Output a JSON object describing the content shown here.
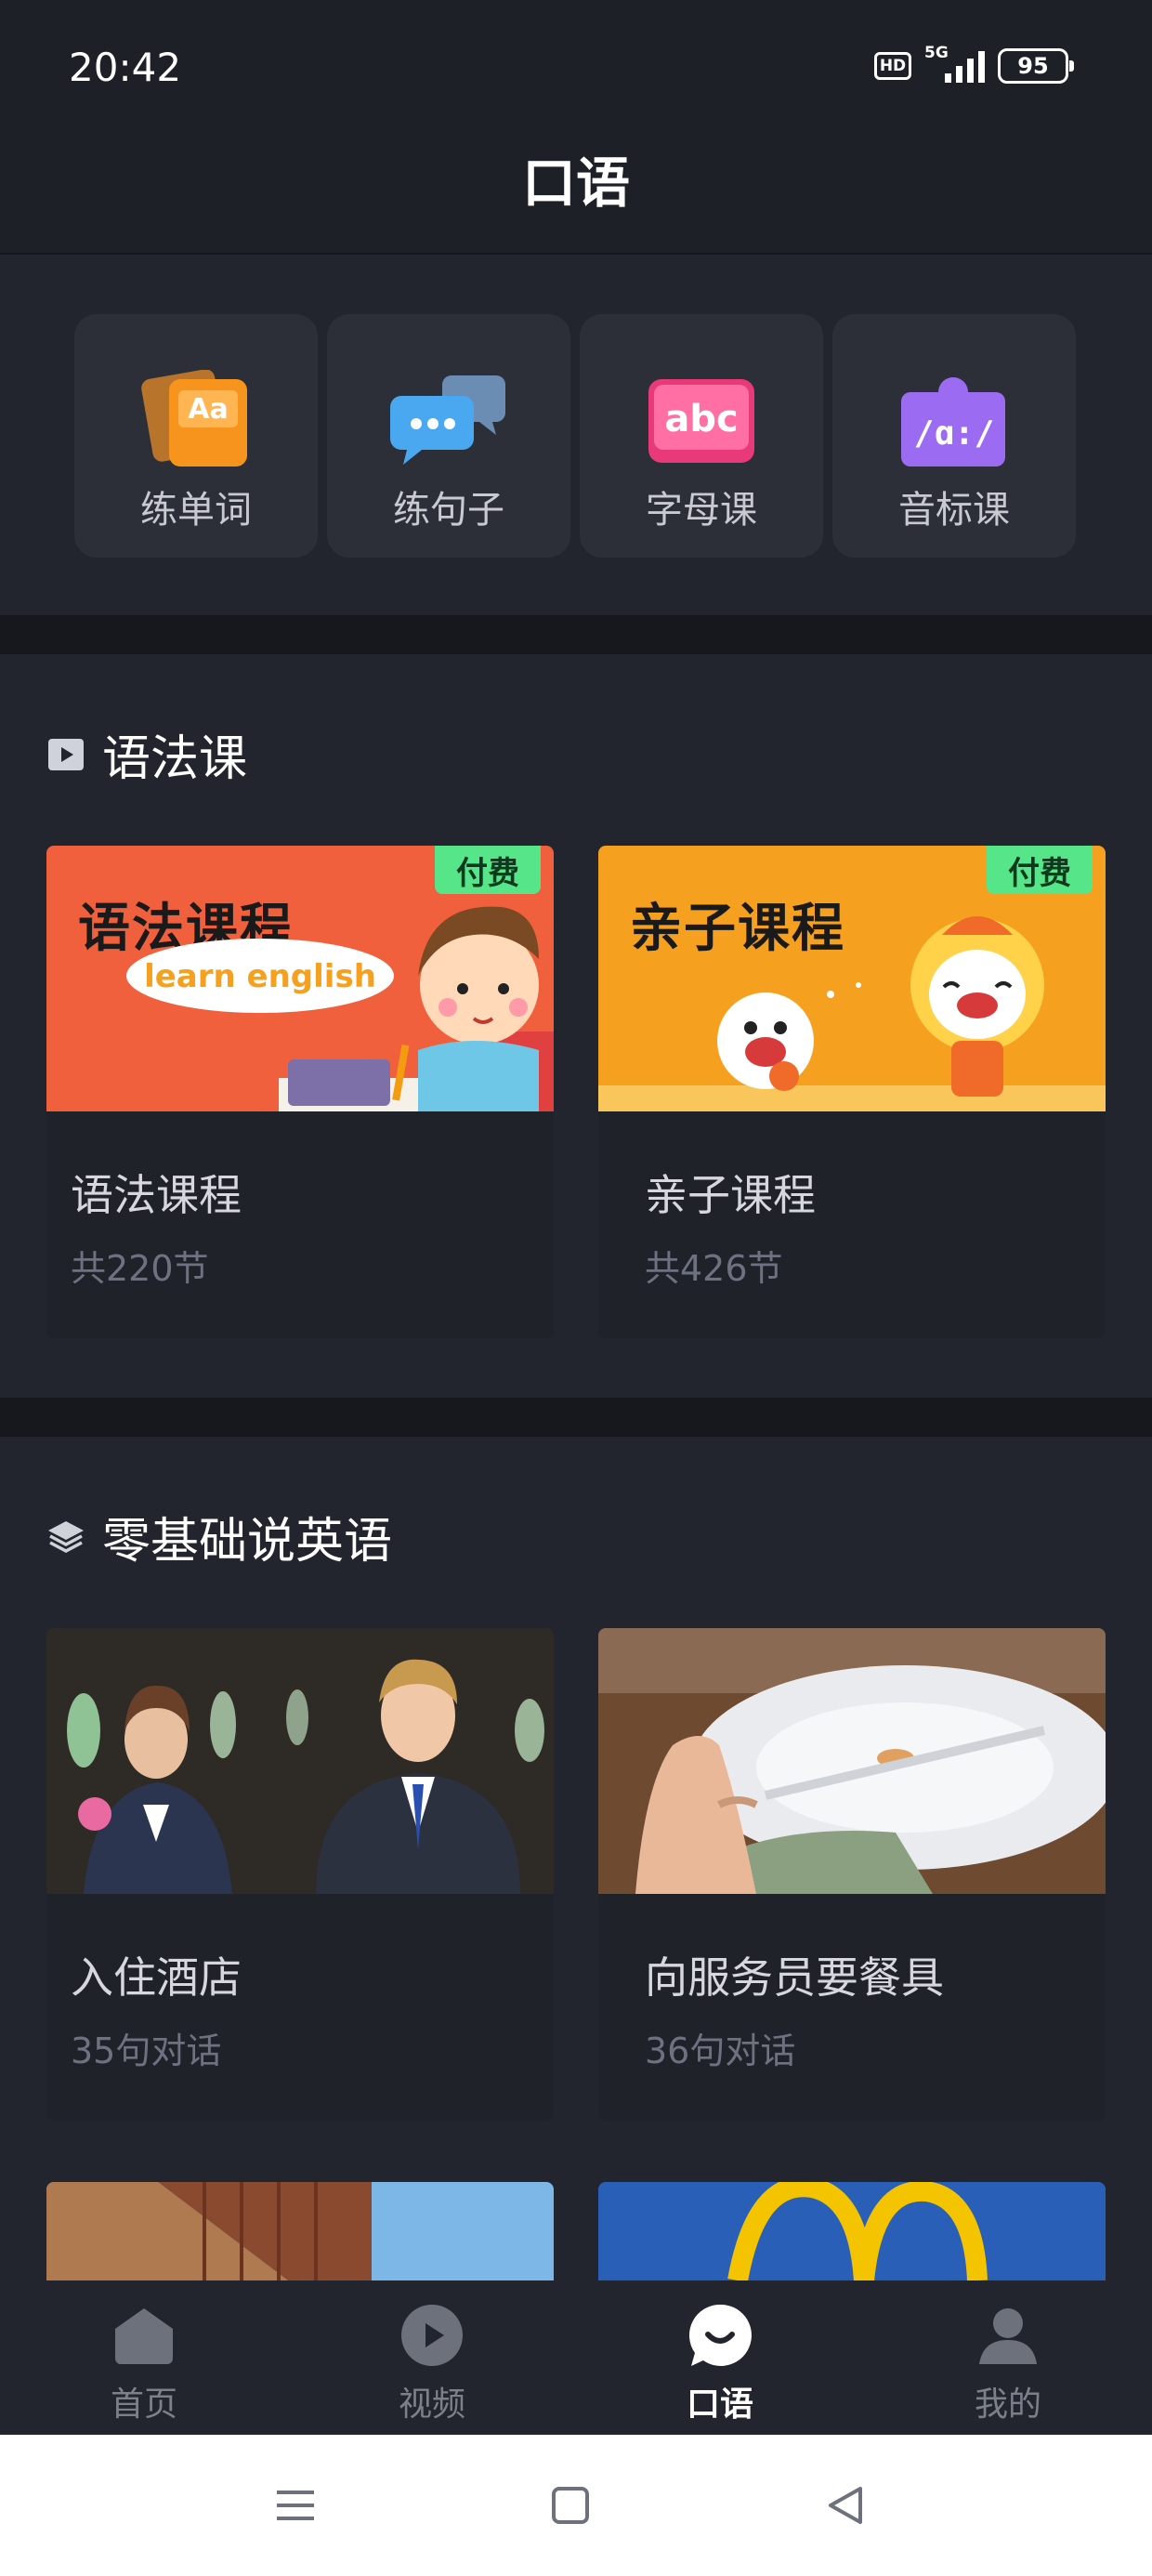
{
  "status_bar": {
    "time": "20:42",
    "hd": "HD",
    "network": "5G",
    "battery": "95"
  },
  "header": {
    "title": "口语"
  },
  "quick_entries": [
    {
      "label": "练单词",
      "icon": "word-card-icon",
      "color": "#f7941d"
    },
    {
      "label": "练句子",
      "icon": "chat-bubbles-icon",
      "color": "#4aa8f0"
    },
    {
      "label": "字母课",
      "icon": "abc-icon",
      "color": "#f0508a"
    },
    {
      "label": "音标课",
      "icon": "phonetic-icon",
      "color": "#9b6cf2"
    }
  ],
  "grammar_section": {
    "title": "语法课",
    "icon": "play-square-icon",
    "courses": [
      {
        "cover_title": "语法课程",
        "cover_caption": "learn english",
        "badge": "付费",
        "name": "语法课程",
        "meta": "共220节",
        "cover_color": "#f0603c"
      },
      {
        "cover_title": "亲子课程",
        "badge": "付费",
        "name": "亲子课程",
        "meta": "共426节",
        "cover_color": "#f5a01f"
      }
    ]
  },
  "basic_section": {
    "title": "零基础说英语",
    "icon": "layers-icon",
    "lessons": [
      {
        "name": "入住酒店",
        "meta": "35句对话",
        "cover_color": "#3a3f4a"
      },
      {
        "name": "向服务员要餐具",
        "meta": "36句对话",
        "cover_color": "#8a6a4a"
      }
    ]
  },
  "bottom_nav": [
    {
      "label": "首页",
      "icon": "home-icon",
      "active": false
    },
    {
      "label": "视频",
      "icon": "video-play-icon",
      "active": false
    },
    {
      "label": "口语",
      "icon": "speech-bubble-icon",
      "active": true
    },
    {
      "label": "我的",
      "icon": "user-icon",
      "active": false
    }
  ],
  "colors": {
    "background": "#1d2027",
    "panel": "#22252d",
    "card": "#2c2f38",
    "paid_badge": "#57e58a",
    "inactive_nav": "#7c808b"
  }
}
